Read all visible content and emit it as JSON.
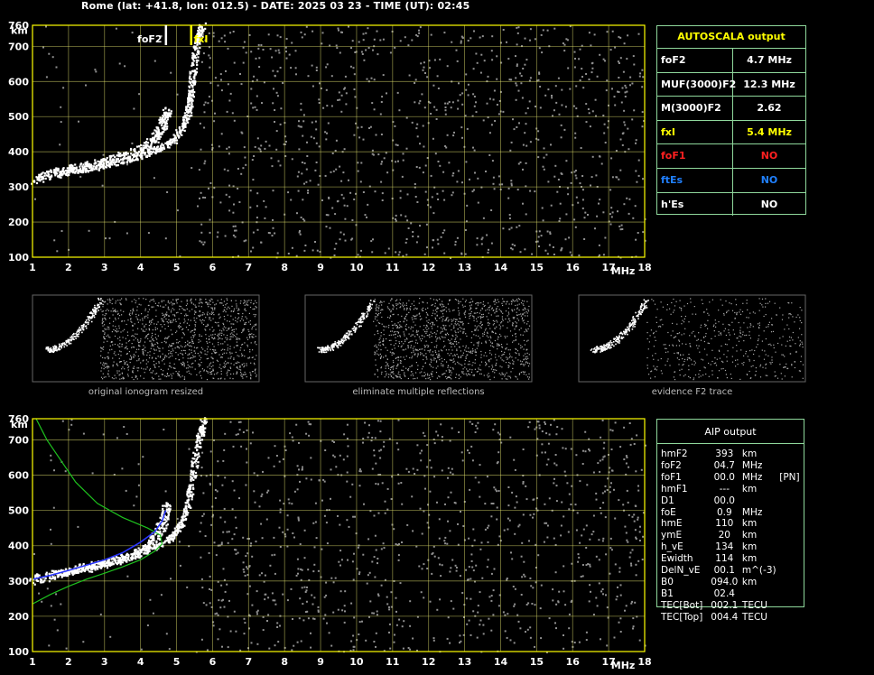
{
  "header": "Rome (lat: +41.8, lon: 012.5) - DATE: 2025 03 23 - TIME (UT): 02:45",
  "colors": {
    "grid": "#e8e870",
    "axis": "#ffff00",
    "trace": "#ffffff",
    "noise": "#909090",
    "fit_blue": "#2a36ff",
    "fit_green": "#1ec21e",
    "table_border": "#8fd89c",
    "fof2_marker": "#ffffff",
    "fxi_marker": "#ffff00",
    "red": "#ff2020",
    "blue": "#2080ff",
    "yellow": "#ffff00"
  },
  "chart_data": [
    {
      "type": "scatter",
      "name_id": "top-ionogram",
      "xlabel": "MHz",
      "ylabel": "km",
      "xlim": [
        1,
        18
      ],
      "ylim": [
        100,
        760
      ],
      "x_ticks": [
        1,
        2,
        3,
        4,
        5,
        6,
        7,
        8,
        9,
        10,
        11,
        12,
        13,
        14,
        15,
        16,
        17,
        18
      ],
      "y_ticks": [
        100,
        200,
        300,
        400,
        500,
        600,
        700,
        760
      ],
      "markers": [
        {
          "label": "foF2",
          "freq": 4.7
        },
        {
          "label": "fxI",
          "freq": 5.4
        }
      ],
      "trace_o": [
        [
          1.0,
          320
        ],
        [
          1.5,
          340
        ],
        [
          2.0,
          352
        ],
        [
          2.5,
          362
        ],
        [
          3.0,
          374
        ],
        [
          3.5,
          390
        ],
        [
          4.0,
          410
        ],
        [
          4.3,
          430
        ],
        [
          4.5,
          455
        ],
        [
          4.65,
          490
        ],
        [
          4.72,
          520
        ]
      ],
      "trace_x": [
        [
          1.6,
          335
        ],
        [
          2.2,
          348
        ],
        [
          2.8,
          360
        ],
        [
          3.4,
          373
        ],
        [
          4.0,
          390
        ],
        [
          4.5,
          410
        ],
        [
          4.9,
          435
        ],
        [
          5.15,
          470
        ],
        [
          5.3,
          510
        ],
        [
          5.38,
          560
        ],
        [
          5.42,
          610
        ],
        [
          5.5,
          680
        ],
        [
          5.6,
          730
        ],
        [
          5.7,
          760
        ]
      ]
    },
    {
      "type": "scatter",
      "name_id": "bottom-ionogram",
      "xlabel": "MHz",
      "ylabel": "km",
      "xlim": [
        1,
        18
      ],
      "ylim": [
        100,
        760
      ],
      "x_ticks": [
        1,
        2,
        3,
        4,
        5,
        6,
        7,
        8,
        9,
        10,
        11,
        12,
        13,
        14,
        15,
        16,
        17,
        18
      ],
      "y_ticks": [
        100,
        200,
        300,
        400,
        500,
        600,
        700,
        760
      ],
      "trace_o": [
        [
          1.0,
          305
        ],
        [
          1.5,
          318
        ],
        [
          2.0,
          330
        ],
        [
          2.5,
          340
        ],
        [
          3.0,
          352
        ],
        [
          3.5,
          365
        ],
        [
          4.0,
          385
        ],
        [
          4.3,
          410
        ],
        [
          4.5,
          445
        ],
        [
          4.65,
          480
        ],
        [
          4.72,
          520
        ]
      ],
      "trace_x": [
        [
          1.6,
          320
        ],
        [
          2.2,
          334
        ],
        [
          2.8,
          348
        ],
        [
          3.4,
          362
        ],
        [
          4.0,
          380
        ],
        [
          4.5,
          405
        ],
        [
          4.9,
          430
        ],
        [
          5.15,
          470
        ],
        [
          5.3,
          520
        ],
        [
          5.4,
          580
        ],
        [
          5.5,
          650
        ],
        [
          5.65,
          720
        ],
        [
          5.75,
          760
        ]
      ],
      "fit_blue": [
        [
          1.0,
          305
        ],
        [
          1.5,
          316
        ],
        [
          2.0,
          330
        ],
        [
          2.5,
          345
        ],
        [
          3.0,
          360
        ],
        [
          3.5,
          380
        ],
        [
          4.0,
          410
        ],
        [
          4.4,
          440
        ],
        [
          4.6,
          470
        ],
        [
          4.7,
          500
        ]
      ],
      "fit_green": [
        [
          1.0,
          235
        ],
        [
          1.5,
          262
        ],
        [
          2.0,
          285
        ],
        [
          2.5,
          305
        ],
        [
          3.0,
          322
        ],
        [
          3.5,
          340
        ],
        [
          4.0,
          360
        ],
        [
          4.4,
          385
        ],
        [
          4.6,
          405
        ],
        [
          4.55,
          430
        ],
        [
          4.2,
          450
        ],
        [
          3.5,
          480
        ],
        [
          2.8,
          520
        ],
        [
          2.2,
          580
        ],
        [
          1.8,
          640
        ],
        [
          1.4,
          700
        ],
        [
          1.1,
          760
        ]
      ]
    }
  ],
  "thumbnails": [
    {
      "caption": "original ionogram resized"
    },
    {
      "caption": "eliminate multiple reflections"
    },
    {
      "caption": "evidence F2 trace"
    }
  ],
  "autoscala": {
    "title": "AUTOSCALA output",
    "rows": [
      {
        "key": "foF2",
        "value": "4.7 MHz",
        "color": "#ffffff"
      },
      {
        "key": "MUF(3000)F2",
        "value": "12.3 MHz",
        "color": "#ffffff"
      },
      {
        "key": "M(3000)F2",
        "value": "2.62",
        "color": "#ffffff"
      },
      {
        "key": "fxI",
        "value": "5.4 MHz",
        "color": "#ffff00"
      },
      {
        "key": "foF1",
        "value": "NO",
        "color": "#ff2020"
      },
      {
        "key": "ftEs",
        "value": "NO",
        "color": "#2080ff"
      },
      {
        "key": "h'Es",
        "value": "NO",
        "color": "#ffffff"
      }
    ]
  },
  "aip": {
    "title": "AIP output",
    "rows": [
      {
        "k": "hmF2",
        "v": "393",
        "u": "km",
        "x": ""
      },
      {
        "k": "foF2",
        "v": "04.7",
        "u": "MHz",
        "x": ""
      },
      {
        "k": "foF1",
        "v": "00.0",
        "u": "MHz",
        "x": "[PN]"
      },
      {
        "k": "hmF1",
        "v": "---",
        "u": "km",
        "x": ""
      },
      {
        "k": "D1",
        "v": "00.0",
        "u": "",
        "x": ""
      },
      {
        "k": "foE",
        "v": "0.9",
        "u": "MHz",
        "x": ""
      },
      {
        "k": "hmE",
        "v": "110",
        "u": "km",
        "x": ""
      },
      {
        "k": "ymE",
        "v": "20",
        "u": "km",
        "x": ""
      },
      {
        "k": "h_vE",
        "v": "134",
        "u": "km",
        "x": ""
      },
      {
        "k": "Ewidth",
        "v": "114",
        "u": "km",
        "x": ""
      },
      {
        "k": "DelN_vE",
        "v": "00.1",
        "u": "m^(-3)",
        "x": ""
      },
      {
        "k": "B0",
        "v": "094.0",
        "u": "km",
        "x": ""
      },
      {
        "k": "B1",
        "v": "02.4",
        "u": "",
        "x": ""
      },
      {
        "k": "TEC[Bot]",
        "v": "002.1",
        "u": "TECU",
        "x": ""
      },
      {
        "k": "TEC[Top]",
        "v": "004.4",
        "u": "TECU",
        "x": ""
      }
    ]
  }
}
